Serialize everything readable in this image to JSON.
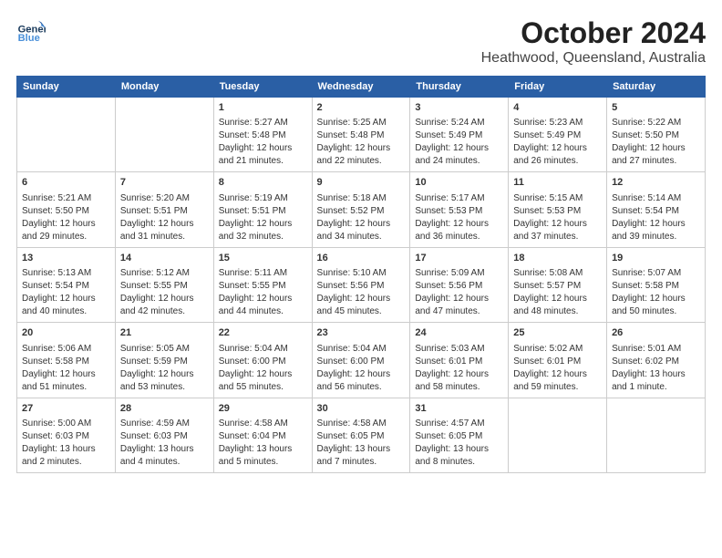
{
  "logo": {
    "line1": "General",
    "line2": "Blue"
  },
  "title": "October 2024",
  "location": "Heathwood, Queensland, Australia",
  "headers": [
    "Sunday",
    "Monday",
    "Tuesday",
    "Wednesday",
    "Thursday",
    "Friday",
    "Saturday"
  ],
  "weeks": [
    [
      {
        "day": "",
        "empty": true
      },
      {
        "day": "",
        "empty": true
      },
      {
        "day": "1",
        "sunrise": "Sunrise: 5:27 AM",
        "sunset": "Sunset: 5:48 PM",
        "daylight": "Daylight: 12 hours and 21 minutes."
      },
      {
        "day": "2",
        "sunrise": "Sunrise: 5:25 AM",
        "sunset": "Sunset: 5:48 PM",
        "daylight": "Daylight: 12 hours and 22 minutes."
      },
      {
        "day": "3",
        "sunrise": "Sunrise: 5:24 AM",
        "sunset": "Sunset: 5:49 PM",
        "daylight": "Daylight: 12 hours and 24 minutes."
      },
      {
        "day": "4",
        "sunrise": "Sunrise: 5:23 AM",
        "sunset": "Sunset: 5:49 PM",
        "daylight": "Daylight: 12 hours and 26 minutes."
      },
      {
        "day": "5",
        "sunrise": "Sunrise: 5:22 AM",
        "sunset": "Sunset: 5:50 PM",
        "daylight": "Daylight: 12 hours and 27 minutes."
      }
    ],
    [
      {
        "day": "6",
        "sunrise": "Sunrise: 5:21 AM",
        "sunset": "Sunset: 5:50 PM",
        "daylight": "Daylight: 12 hours and 29 minutes."
      },
      {
        "day": "7",
        "sunrise": "Sunrise: 5:20 AM",
        "sunset": "Sunset: 5:51 PM",
        "daylight": "Daylight: 12 hours and 31 minutes."
      },
      {
        "day": "8",
        "sunrise": "Sunrise: 5:19 AM",
        "sunset": "Sunset: 5:51 PM",
        "daylight": "Daylight: 12 hours and 32 minutes."
      },
      {
        "day": "9",
        "sunrise": "Sunrise: 5:18 AM",
        "sunset": "Sunset: 5:52 PM",
        "daylight": "Daylight: 12 hours and 34 minutes."
      },
      {
        "day": "10",
        "sunrise": "Sunrise: 5:17 AM",
        "sunset": "Sunset: 5:53 PM",
        "daylight": "Daylight: 12 hours and 36 minutes."
      },
      {
        "day": "11",
        "sunrise": "Sunrise: 5:15 AM",
        "sunset": "Sunset: 5:53 PM",
        "daylight": "Daylight: 12 hours and 37 minutes."
      },
      {
        "day": "12",
        "sunrise": "Sunrise: 5:14 AM",
        "sunset": "Sunset: 5:54 PM",
        "daylight": "Daylight: 12 hours and 39 minutes."
      }
    ],
    [
      {
        "day": "13",
        "sunrise": "Sunrise: 5:13 AM",
        "sunset": "Sunset: 5:54 PM",
        "daylight": "Daylight: 12 hours and 40 minutes."
      },
      {
        "day": "14",
        "sunrise": "Sunrise: 5:12 AM",
        "sunset": "Sunset: 5:55 PM",
        "daylight": "Daylight: 12 hours and 42 minutes."
      },
      {
        "day": "15",
        "sunrise": "Sunrise: 5:11 AM",
        "sunset": "Sunset: 5:55 PM",
        "daylight": "Daylight: 12 hours and 44 minutes."
      },
      {
        "day": "16",
        "sunrise": "Sunrise: 5:10 AM",
        "sunset": "Sunset: 5:56 PM",
        "daylight": "Daylight: 12 hours and 45 minutes."
      },
      {
        "day": "17",
        "sunrise": "Sunrise: 5:09 AM",
        "sunset": "Sunset: 5:56 PM",
        "daylight": "Daylight: 12 hours and 47 minutes."
      },
      {
        "day": "18",
        "sunrise": "Sunrise: 5:08 AM",
        "sunset": "Sunset: 5:57 PM",
        "daylight": "Daylight: 12 hours and 48 minutes."
      },
      {
        "day": "19",
        "sunrise": "Sunrise: 5:07 AM",
        "sunset": "Sunset: 5:58 PM",
        "daylight": "Daylight: 12 hours and 50 minutes."
      }
    ],
    [
      {
        "day": "20",
        "sunrise": "Sunrise: 5:06 AM",
        "sunset": "Sunset: 5:58 PM",
        "daylight": "Daylight: 12 hours and 51 minutes."
      },
      {
        "day": "21",
        "sunrise": "Sunrise: 5:05 AM",
        "sunset": "Sunset: 5:59 PM",
        "daylight": "Daylight: 12 hours and 53 minutes."
      },
      {
        "day": "22",
        "sunrise": "Sunrise: 5:04 AM",
        "sunset": "Sunset: 6:00 PM",
        "daylight": "Daylight: 12 hours and 55 minutes."
      },
      {
        "day": "23",
        "sunrise": "Sunrise: 5:04 AM",
        "sunset": "Sunset: 6:00 PM",
        "daylight": "Daylight: 12 hours and 56 minutes."
      },
      {
        "day": "24",
        "sunrise": "Sunrise: 5:03 AM",
        "sunset": "Sunset: 6:01 PM",
        "daylight": "Daylight: 12 hours and 58 minutes."
      },
      {
        "day": "25",
        "sunrise": "Sunrise: 5:02 AM",
        "sunset": "Sunset: 6:01 PM",
        "daylight": "Daylight: 12 hours and 59 minutes."
      },
      {
        "day": "26",
        "sunrise": "Sunrise: 5:01 AM",
        "sunset": "Sunset: 6:02 PM",
        "daylight": "Daylight: 13 hours and 1 minute."
      }
    ],
    [
      {
        "day": "27",
        "sunrise": "Sunrise: 5:00 AM",
        "sunset": "Sunset: 6:03 PM",
        "daylight": "Daylight: 13 hours and 2 minutes."
      },
      {
        "day": "28",
        "sunrise": "Sunrise: 4:59 AM",
        "sunset": "Sunset: 6:03 PM",
        "daylight": "Daylight: 13 hours and 4 minutes."
      },
      {
        "day": "29",
        "sunrise": "Sunrise: 4:58 AM",
        "sunset": "Sunset: 6:04 PM",
        "daylight": "Daylight: 13 hours and 5 minutes."
      },
      {
        "day": "30",
        "sunrise": "Sunrise: 4:58 AM",
        "sunset": "Sunset: 6:05 PM",
        "daylight": "Daylight: 13 hours and 7 minutes."
      },
      {
        "day": "31",
        "sunrise": "Sunrise: 4:57 AM",
        "sunset": "Sunset: 6:05 PM",
        "daylight": "Daylight: 13 hours and 8 minutes."
      },
      {
        "day": "",
        "empty": true
      },
      {
        "day": "",
        "empty": true
      }
    ]
  ]
}
